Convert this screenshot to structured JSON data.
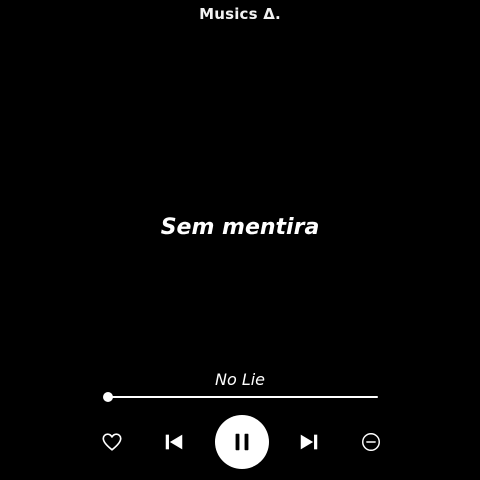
{
  "header": {
    "app_title": "Musics Δ."
  },
  "lyrics": {
    "current_line": "Sem mentira"
  },
  "player": {
    "track_title": "No Lie",
    "progress_fraction": 0.0,
    "is_playing": true,
    "controls": [
      {
        "name": "like-button",
        "icon": "heart-outline-icon"
      },
      {
        "name": "previous-button",
        "icon": "skip-previous-icon"
      },
      {
        "name": "pause-button",
        "icon": "pause-icon"
      },
      {
        "name": "next-button",
        "icon": "skip-next-icon"
      },
      {
        "name": "remove-button",
        "icon": "minus-circle-icon"
      }
    ]
  },
  "colors": {
    "background": "#000000",
    "foreground": "#ffffff"
  }
}
